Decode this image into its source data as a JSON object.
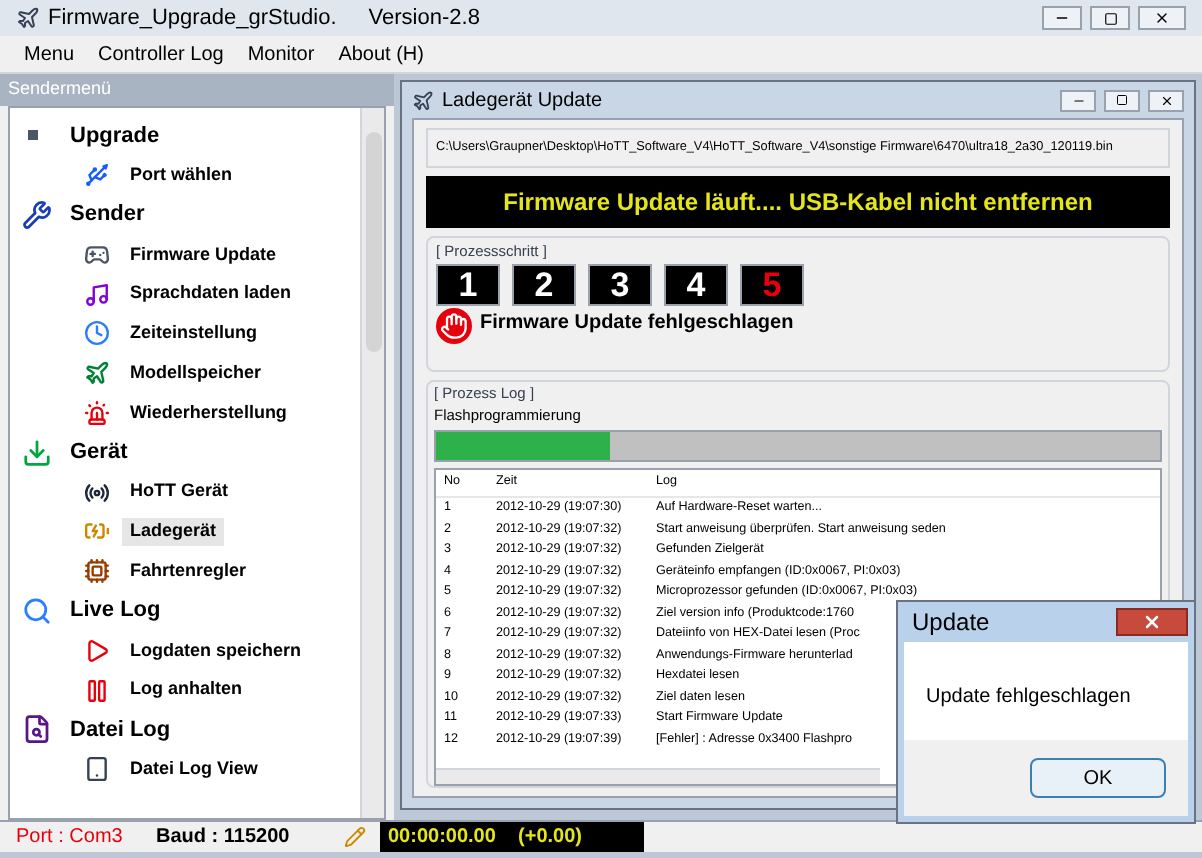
{
  "window": {
    "title": "Firmware_Upgrade_grStudio.",
    "version": "Version-2.8"
  },
  "menu": [
    "Menu",
    "Controller Log",
    "Monitor",
    "About (H)"
  ],
  "sidebar": {
    "title": "Sendermenü",
    "tree": [
      {
        "label": "Upgrade",
        "kind": "root",
        "selected": false,
        "children": [
          {
            "label": "Port wählen",
            "kind": "usb",
            "selected": false
          }
        ]
      },
      {
        "label": "Sender",
        "kind": "wrench",
        "selected": false,
        "children": [
          {
            "label": "Firmware Update",
            "kind": "remote",
            "selected": false
          },
          {
            "label": "Sprachdaten laden",
            "kind": "music",
            "selected": false
          },
          {
            "label": "Zeiteinstellung",
            "kind": "clock",
            "selected": false
          },
          {
            "label": "Modellspeicher",
            "kind": "plane",
            "selected": false
          },
          {
            "label": "Wiederherstellung",
            "kind": "alarm",
            "selected": false
          }
        ]
      },
      {
        "label": "Gerät",
        "kind": "download",
        "selected": false,
        "children": [
          {
            "label": "HoTT Gerät",
            "kind": "antenna",
            "selected": false
          },
          {
            "label": "Ladegerät",
            "kind": "charger",
            "selected": true
          },
          {
            "label": "Fahrtenregler",
            "kind": "esc",
            "selected": false
          }
        ]
      },
      {
        "label": "Live Log",
        "kind": "search",
        "selected": false,
        "children": [
          {
            "label": "Logdaten speichern",
            "kind": "record",
            "selected": false
          },
          {
            "label": "Log anhalten",
            "kind": "pause",
            "selected": false
          }
        ]
      },
      {
        "label": "Datei Log",
        "kind": "file",
        "selected": false,
        "children": [
          {
            "label": "Datei Log View",
            "kind": "tablet",
            "selected": false
          }
        ]
      }
    ]
  },
  "status_bar": {
    "port": "Port : Com3",
    "baud": "Baud : 115200",
    "timer": "00:00:00.00    (+0.00)"
  },
  "child_window": {
    "title": "Ladegerät Update",
    "path": "C:\\Users\\Graupner\\Desktop\\HoTT_Software_V4\\HoTT_Software_V4\\sonstige Firmware\\6470\\ultra18_2a30_120119.bin",
    "banner": "Firmware Update läuft.... USB-Kabel nicht entfernen",
    "steps_title": "[ Prozessschritt ]",
    "steps": [
      {
        "label": "1",
        "failed": false
      },
      {
        "label": "2",
        "failed": false
      },
      {
        "label": "3",
        "failed": false
      },
      {
        "label": "4",
        "failed": false
      },
      {
        "label": "5",
        "failed": true
      }
    ],
    "status": "Firmware Update fehlgeschlagen",
    "log_title": "[ Prozess Log ]",
    "progress_label": "Flashprogrammierung",
    "progress": {
      "level": 0.24
    },
    "table": {
      "columns": [
        "No",
        "Zeit",
        "Log"
      ],
      "rows": [
        [
          "1",
          "2012-10-29 (19:07:30)",
          "Auf Hardware-Reset warten..."
        ],
        [
          "2",
          "2012-10-29 (19:07:32)",
          "Start anweisung überprüfen. Start anweisung seden"
        ],
        [
          "3",
          "2012-10-29 (19:07:32)",
          "Gefunden Zielgerät"
        ],
        [
          "4",
          "2012-10-29 (19:07:32)",
          "Geräteinfo empfangen (ID:0x0067, PI:0x03)"
        ],
        [
          "5",
          "2012-10-29 (19:07:32)",
          "Microprozessor gefunden (ID:0x0067, PI:0x03)"
        ],
        [
          "6",
          "2012-10-29 (19:07:32)",
          "Ziel version info (Produktcode:1760"
        ],
        [
          "7",
          "2012-10-29 (19:07:32)",
          "Dateiinfo von HEX-Datei lesen (Proc"
        ],
        [
          "8",
          "2012-10-29 (19:07:32)",
          "Anwendungs-Firmware herunterlad"
        ],
        [
          "9",
          "2012-10-29 (19:07:32)",
          "Hexdatei lesen"
        ],
        [
          "10",
          "2012-10-29 (19:07:32)",
          "Ziel daten lesen"
        ],
        [
          "11",
          "2012-10-29 (19:07:33)",
          "Start Firmware Update"
        ],
        [
          "12",
          "2012-10-29 (19:07:39)",
          "[Fehler] : Adresse 0x3400 Flashpro"
        ]
      ]
    }
  },
  "dialog": {
    "title": "Update",
    "message": "Update fehlgeschlagen",
    "button": "OK"
  }
}
